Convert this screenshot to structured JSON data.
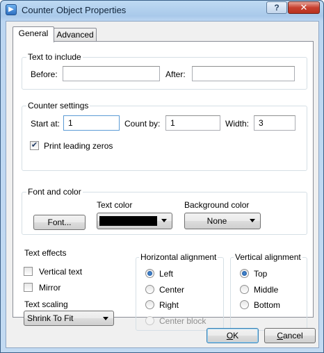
{
  "window": {
    "title": "Counter Object Properties",
    "help_label": "?",
    "close_label": "✕"
  },
  "tabs": [
    {
      "label": "General",
      "active": true
    },
    {
      "label": "Advanced",
      "active": false
    }
  ],
  "text_to_include": {
    "legend": "Text to include",
    "before_label": "Before:",
    "before_value": "",
    "after_label": "After:",
    "after_value": ""
  },
  "counter_settings": {
    "legend": "Counter settings",
    "start_label": "Start at:",
    "start_value": "1",
    "count_label": "Count by:",
    "count_value": "1",
    "width_label": "Width:",
    "width_value": "3",
    "leading_zeros_label": "Print leading zeros",
    "leading_zeros_checked": true
  },
  "font_and_color": {
    "legend": "Font and color",
    "font_button": "Font...",
    "text_color_label": "Text color",
    "text_color_value": "#000000",
    "background_color_label": "Background color",
    "background_color_value": "None"
  },
  "text_effects": {
    "legend": "Text effects",
    "vertical_text_label": "Vertical text",
    "vertical_text_checked": false,
    "mirror_label": "Mirror",
    "mirror_checked": false,
    "text_scaling_label": "Text scaling",
    "text_scaling_value": "Shrink To Fit"
  },
  "horizontal_alignment": {
    "legend": "Horizontal alignment",
    "options": [
      {
        "label": "Left",
        "selected": true,
        "enabled": true
      },
      {
        "label": "Center",
        "selected": false,
        "enabled": true
      },
      {
        "label": "Right",
        "selected": false,
        "enabled": true
      },
      {
        "label": "Center block",
        "selected": false,
        "enabled": false
      }
    ]
  },
  "vertical_alignment": {
    "legend": "Vertical alignment",
    "options": [
      {
        "label": "Top",
        "selected": true
      },
      {
        "label": "Middle",
        "selected": false
      },
      {
        "label": "Bottom",
        "selected": false
      }
    ]
  },
  "footer": {
    "ok_mnemonic": "O",
    "ok_rest": "K",
    "cancel_mnemonic": "C",
    "cancel_rest": "ancel"
  }
}
